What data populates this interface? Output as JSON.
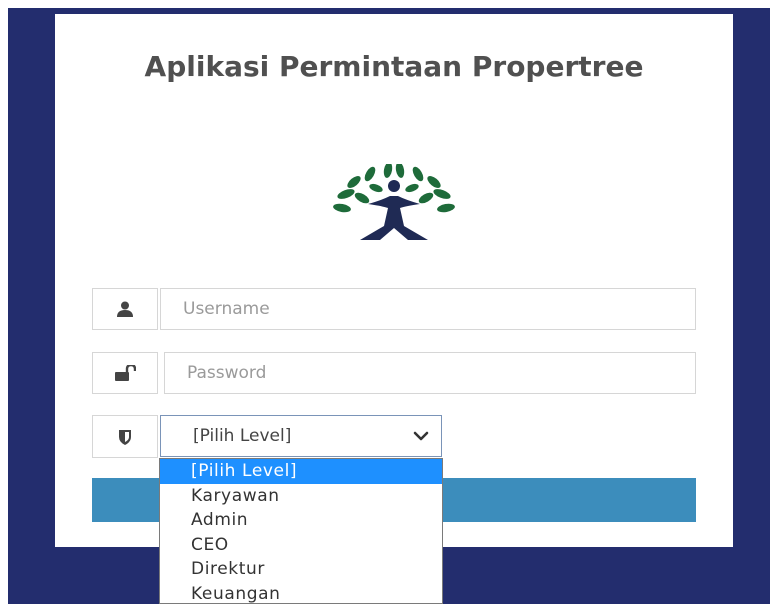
{
  "app": {
    "title": "Aplikasi Permintaan Propertree"
  },
  "form": {
    "username_placeholder": "Username",
    "password_placeholder": "Password",
    "level_selected": "[Pilih Level]",
    "level_options": [
      "[Pilih Level]",
      "Karyawan",
      "Admin",
      "CEO",
      "Direktur",
      "Keuangan"
    ],
    "login_label": ""
  },
  "colors": {
    "background": "#232d6e",
    "button": "#3c8dbc",
    "selected_option": "#1e90ff",
    "logo_leaf": "#1e6b3a",
    "logo_figure": "#1f2a54"
  },
  "icons": {
    "username": "user-icon",
    "password": "unlock-icon",
    "level": "shield-icon",
    "select": "chevron-down-icon"
  }
}
